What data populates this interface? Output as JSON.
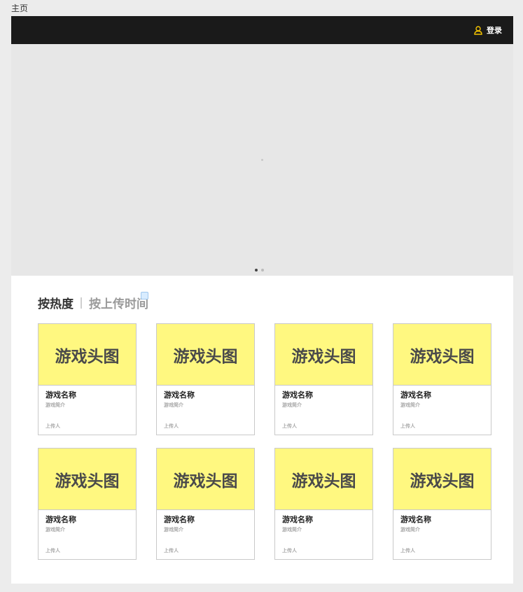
{
  "page_label": "主页",
  "header": {
    "login_label": "登录"
  },
  "carousel": {
    "page_count": 2,
    "active_index": 0
  },
  "sort_tabs": {
    "hot": "按热度",
    "upload_time": "按上传时间"
  },
  "cards": [
    {
      "thumb": "游戏头图",
      "name": "游戏名称",
      "desc": "游戏简介",
      "uploader": "上传人"
    },
    {
      "thumb": "游戏头图",
      "name": "游戏名称",
      "desc": "游戏简介",
      "uploader": "上传人"
    },
    {
      "thumb": "游戏头图",
      "name": "游戏名称",
      "desc": "游戏简介",
      "uploader": "上传人"
    },
    {
      "thumb": "游戏头图",
      "name": "游戏名称",
      "desc": "游戏简介",
      "uploader": "上传人"
    },
    {
      "thumb": "游戏头图",
      "name": "游戏名称",
      "desc": "游戏简介",
      "uploader": "上传人"
    },
    {
      "thumb": "游戏头图",
      "name": "游戏名称",
      "desc": "游戏简介",
      "uploader": "上传人"
    },
    {
      "thumb": "游戏头图",
      "name": "游戏名称",
      "desc": "游戏简介",
      "uploader": "上传人"
    },
    {
      "thumb": "游戏头图",
      "name": "游戏名称",
      "desc": "游戏简介",
      "uploader": "上传人"
    }
  ],
  "colors": {
    "topbar": "#1a1a1a",
    "accent_icon": "#f5c400",
    "thumb_bg": "#fff880"
  },
  "icons": {
    "login": "user-icon"
  }
}
